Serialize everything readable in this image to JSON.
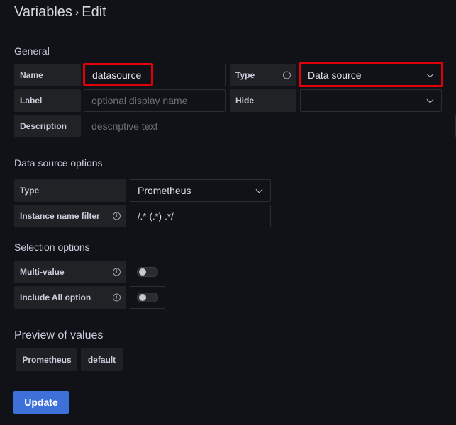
{
  "page": {
    "title_left": "Variables",
    "title_sep": "›",
    "title_right": "Edit"
  },
  "general": {
    "heading": "General",
    "name_label": "Name",
    "name_value": "datasource",
    "type_label": "Type",
    "type_value": "Data source",
    "label_label": "Label",
    "label_placeholder": "optional display name",
    "hide_label": "Hide",
    "hide_value": "",
    "description_label": "Description",
    "description_placeholder": "descriptive text",
    "info_glyph": "i"
  },
  "datasource_options": {
    "heading": "Data source options",
    "type_label": "Type",
    "type_value": "Prometheus",
    "filter_label": "Instance name filter",
    "filter_value": "/.*-(.*)-.*/"
  },
  "selection_options": {
    "heading": "Selection options",
    "multi_value_label": "Multi-value",
    "multi_value_enabled": false,
    "include_all_label": "Include All option",
    "include_all_enabled": false
  },
  "preview": {
    "heading": "Preview of values",
    "values": [
      "Prometheus",
      "default"
    ]
  },
  "actions": {
    "update_label": "Update"
  },
  "colors": {
    "background": "#111217",
    "highlight": "#e0000a",
    "primary": "#3d71d9"
  }
}
